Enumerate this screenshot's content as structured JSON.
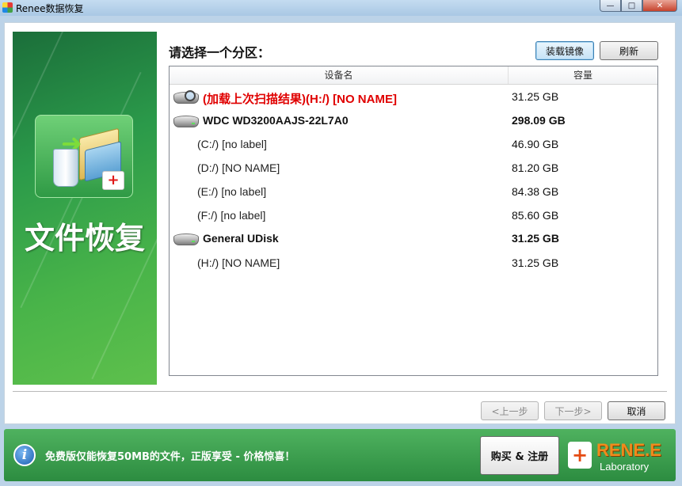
{
  "window": {
    "title": "Renee数据恢复",
    "min_glyph": "—",
    "max_glyph": "□",
    "close_glyph": "✕"
  },
  "banner": {
    "title": "文件恢复",
    "medkit_glyph": "+"
  },
  "main": {
    "prompt": "请选择一个分区：",
    "load_image_label": "装载镜像",
    "refresh_label": "刷新",
    "columns": {
      "name": "设备名",
      "size": "容量"
    },
    "rows": [
      {
        "type": "special",
        "name": "(加载上次扫描结果)(H:/) [NO NAME]",
        "size": "31.25 GB"
      },
      {
        "type": "disk",
        "name": "WDC WD3200AAJS-22L7A0",
        "size": "298.09 GB"
      },
      {
        "type": "part",
        "name": "(C:/) [no label]",
        "size": "46.90 GB"
      },
      {
        "type": "part",
        "name": "(D:/) [NO NAME]",
        "size": "81.20 GB"
      },
      {
        "type": "part",
        "name": "(E:/) [no label]",
        "size": "84.38 GB"
      },
      {
        "type": "part",
        "name": "(F:/) [no label]",
        "size": "85.60 GB"
      },
      {
        "type": "disk",
        "name": "General UDisk",
        "size": "31.25 GB"
      },
      {
        "type": "part",
        "name": "(H:/) [NO NAME]",
        "size": "31.25 GB"
      }
    ]
  },
  "nav": {
    "prev_label": "<上一步",
    "next_label": "下一步>",
    "cancel_label": "取消"
  },
  "footer": {
    "info_glyph": "i",
    "promo_text": "免费版仅能恢复50MB的文件，正版享受 - 价格惊喜！",
    "buy_label": "购买 & 注册",
    "brand_name": "RENE.E",
    "brand_sub": "Laboratory",
    "brand_glyph": "+"
  }
}
